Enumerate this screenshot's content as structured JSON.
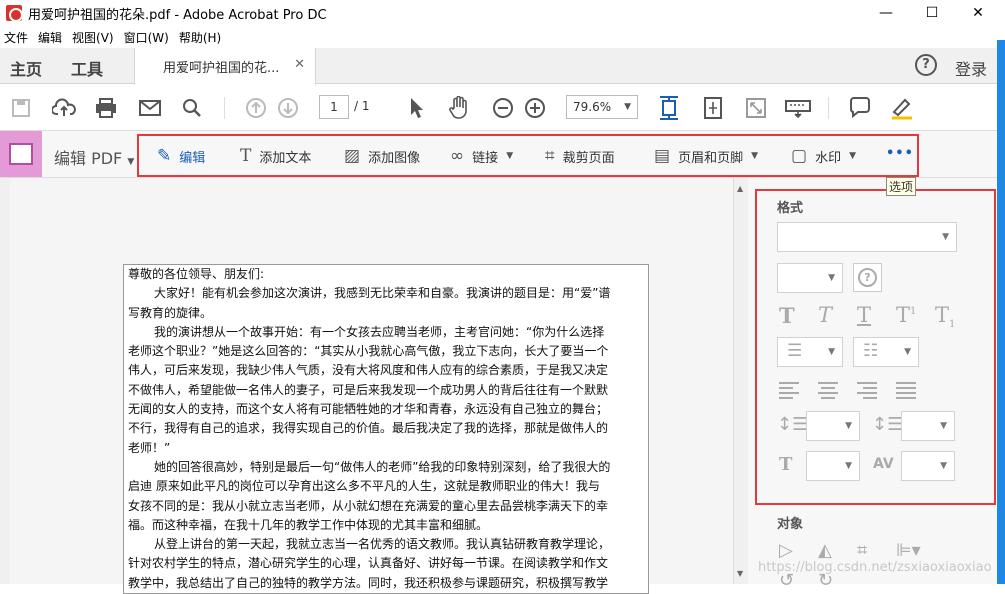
{
  "window": {
    "title": "用爱呵护祖国的花朵.pdf - Adobe Acrobat Pro DC",
    "minimize": "—",
    "maximize": "☐",
    "close": "✕"
  },
  "menu": [
    "文件",
    "编辑",
    "视图(V)",
    "窗口(W)",
    "帮助(H)"
  ],
  "tabs": {
    "home": "主页",
    "tools": "工具",
    "doc": "用爱呵护祖国的花...",
    "doc_close": "✕",
    "help": "?",
    "login": "登录"
  },
  "toolbar": {
    "page_current": "1",
    "page_total": "/ 1",
    "zoom": "79.6%"
  },
  "editbar": {
    "label": "编辑 PDF",
    "tools": [
      {
        "label": "编辑",
        "icon": "edit-icon"
      },
      {
        "label": "添加文本",
        "icon": "text-icon"
      },
      {
        "label": "添加图像",
        "icon": "image-icon"
      },
      {
        "label": "链接",
        "icon": "link-icon"
      },
      {
        "label": "裁剪页面",
        "icon": "crop-icon"
      },
      {
        "label": "页眉和页脚",
        "icon": "header-footer-icon"
      },
      {
        "label": "水印",
        "icon": "watermark-icon"
      }
    ],
    "more": "•••",
    "tooltip": "选项"
  },
  "document": {
    "lines": [
      {
        "text": "尊敬的各位领导、朋友们:",
        "indent": false
      },
      {
        "text": "大家好！能有机会参加这次演讲，我感到无比荣幸和自豪。我演讲的题目是：用“爱”谱",
        "indent": true
      },
      {
        "text": "写教育的旋律。",
        "indent": false
      },
      {
        "text": "我的演讲想从一个故事开始：有一个女孩去应聘当老师，主考官问她：“你为什么选择",
        "indent": true
      },
      {
        "text": "老师这个职业？”她是这么回答的：“其实从小我就心高气傲，我立下志向，长大了要当一个",
        "indent": false
      },
      {
        "text": "伟人，可后来发现，我缺少伟人气质，没有大将风度和伟人应有的综合素质，于是我又决定",
        "indent": false
      },
      {
        "text": "不做伟人，希望能做一名伟人的妻子，可是后来我发现一个成功男人的背后往往有一个默默",
        "indent": false
      },
      {
        "text": "无闻的女人的支持，而这个女人将有可能牺牲她的才华和青春，永远没有自己独立的舞台；",
        "indent": false
      },
      {
        "text": "不行，我得有自己的追求，我得实现自己的价值。最后我决定了我的选择，那就是做伟人的",
        "indent": false
      },
      {
        "text": "老师！”",
        "indent": false
      },
      {
        "text": "她的回答很高妙，特别是最后一句“做伟人的老师”给我的印象特别深刻，给了我很大的",
        "indent": true
      },
      {
        "text": "启迪 原来如此平凡的岗位可以孕育出这么多不平凡的人生，这就是教师职业的伟大！我与",
        "indent": false
      },
      {
        "text": "女孩不同的是：我从小就立志当老师，从小就幻想在充满爱的童心里去品尝桃李满天下的幸",
        "indent": false
      },
      {
        "text": "福。而这种幸福，在我十几年的教学工作中体现的尤其丰富和细腻。",
        "indent": false
      },
      {
        "text": "从登上讲台的第一天起，我就立志当一名优秀的语文教师。我认真钻研教育教学理论，",
        "indent": true
      },
      {
        "text": "针对农村学生的特点，潜心研究学生的心理，认真备好、讲好每一节课。在阅读教学和作文",
        "indent": false
      },
      {
        "text": "教学中，我总结出了自己的独特的教学方法。同时，我还积极参与课题研究，积极撰写教学",
        "indent": false
      }
    ]
  },
  "panel": {
    "format_title": "格式",
    "object_title": "对象"
  },
  "watermark_text": "https://blog.csdn.net/zsxiaoxiaoxiao",
  "colors": {
    "accent": "#1a5fb4",
    "highlight_border": "#e4393c",
    "edit_icon_bg": "#e59ad8"
  }
}
